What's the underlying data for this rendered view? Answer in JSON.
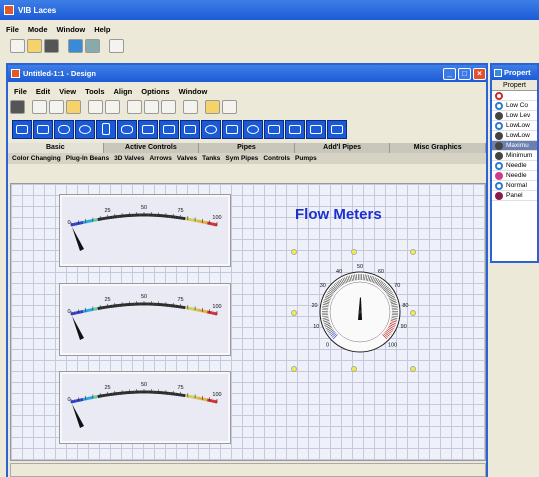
{
  "app": {
    "title": "VIB Laces",
    "menu": [
      "File",
      "Mode",
      "Window",
      "Help"
    ]
  },
  "design": {
    "title": "Untitled-1:1 - Design",
    "menu": [
      "File",
      "Edit",
      "View",
      "Tools",
      "Align",
      "Options",
      "Window"
    ],
    "tabs": [
      "Basic",
      "Active Controls",
      "Pipes",
      "Add'l Pipes",
      "Misc Graphics"
    ],
    "selected_tab": "Basic",
    "subtabs": [
      "Color Changing",
      "Plug-In Beans",
      "3D Valves",
      "Arrows",
      "Valves",
      "Tanks",
      "Sym Pipes",
      "Controls",
      "Pumps"
    ],
    "canvas_title": "Flow Meters",
    "gauge_ticks": [
      "0",
      "25",
      "50",
      "75",
      "100"
    ],
    "round_ticks": [
      "0",
      "10",
      "20",
      "30",
      "40",
      "50",
      "60",
      "70",
      "80",
      "90",
      "100"
    ]
  },
  "properties": {
    "title": "Propert",
    "header": "Propert",
    "items": [
      {
        "label": "",
        "icon": "ring-icon",
        "color": "#cc2a2a"
      },
      {
        "label": "Low Co",
        "icon": "ring-icon",
        "color": "#2a7ad6"
      },
      {
        "label": "Low Lev",
        "icon": "f-icon",
        "color": "#444444"
      },
      {
        "label": "LowLow",
        "icon": "ring-icon",
        "color": "#2a7ad6"
      },
      {
        "label": "LowLow",
        "icon": "f-icon",
        "color": "#444444"
      },
      {
        "label": "Maximu",
        "icon": "f-icon",
        "color": "#444444",
        "selected": true
      },
      {
        "label": "Minimum",
        "icon": "f-icon",
        "color": "#444444"
      },
      {
        "label": "Needle",
        "icon": "ring-icon",
        "color": "#2a7ad6"
      },
      {
        "label": "Needle",
        "icon": "i-icon",
        "color": "#d03a8a"
      },
      {
        "label": "Normal",
        "icon": "ring-icon",
        "color": "#2a7ad6"
      },
      {
        "label": "Panel",
        "icon": "s-icon",
        "color": "#8a1a4a"
      }
    ]
  }
}
